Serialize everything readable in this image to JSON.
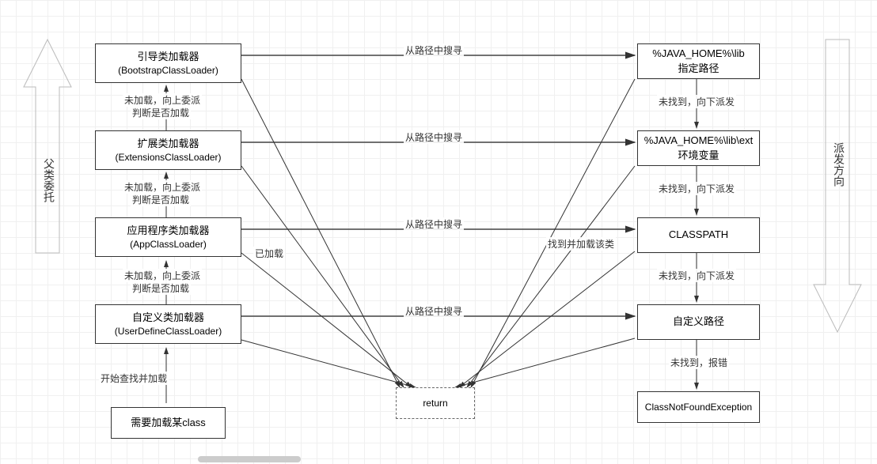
{
  "leftArrow": {
    "label": "父类委托"
  },
  "rightArrow": {
    "label": "派发方向"
  },
  "loaders": {
    "bootstrap": {
      "title": "引导类加载器",
      "sub": "(BootstrapClassLoader)"
    },
    "extension": {
      "title": "扩展类加载器",
      "sub": "(ExtensionsClassLoader)"
    },
    "app": {
      "title": "应用程序类加载器",
      "sub": "(AppClassLoader)"
    },
    "user": {
      "title": "自定义类加载器",
      "sub": "(UserDefineClassLoader)"
    },
    "need": {
      "title": "需要加载某class"
    }
  },
  "paths": {
    "javahome": {
      "line1": "%JAVA_HOME%\\lib",
      "line2": "指定路径"
    },
    "ext": {
      "line1": "%JAVA_HOME%\\lib\\ext",
      "line2": "环境变量"
    },
    "classpath": {
      "line1": "CLASSPATH"
    },
    "custom": {
      "line1": "自定义路径"
    },
    "cnf": {
      "line1": "ClassNotFoundException"
    }
  },
  "returnBox": {
    "label": "return"
  },
  "edgeLabels": {
    "startLoad": "开始查找并加载",
    "delegateAndJudge_l1": "未加载，向上委派",
    "delegateAndJudge_l2": "判断是否加载",
    "searchPath": "从路径中搜寻",
    "loaded": "已加载",
    "foundAndLoad": "找到并加载该类",
    "notFoundDown": "未找到，向下派发",
    "notFoundError": "未找到，报错"
  },
  "scrollbar": {
    "visible": true
  }
}
